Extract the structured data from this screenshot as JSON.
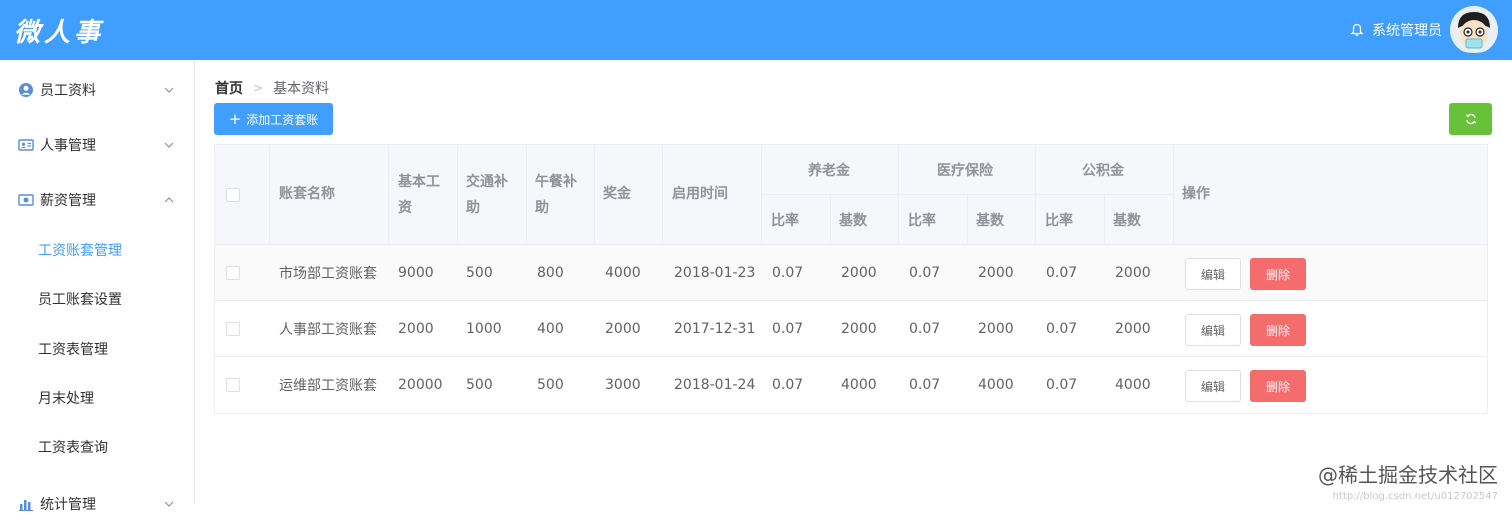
{
  "header": {
    "logo": "微人事",
    "user_name": "系统管理员",
    "bg_color": "#409eff"
  },
  "sidebar": {
    "groups": [
      {
        "label": "员工资料",
        "icon": "user-circle-icon"
      },
      {
        "label": "人事管理",
        "icon": "id-card-icon"
      },
      {
        "label": "薪资管理",
        "icon": "money-icon"
      },
      {
        "label": "统计管理",
        "icon": "bar-chart-icon"
      }
    ],
    "salary_items": [
      {
        "label": "工资账套管理",
        "active": true
      },
      {
        "label": "员工账套设置"
      },
      {
        "label": "工资表管理"
      },
      {
        "label": "月末处理"
      },
      {
        "label": "工资表查询"
      }
    ]
  },
  "breadcrumb": {
    "home": "首页",
    "separator": ">",
    "current": "基本资料"
  },
  "toolbar": {
    "add_label": "添加工资套账",
    "add_plus": "+"
  },
  "table": {
    "headers": {
      "name": "账套名称",
      "basic": "基本工资",
      "traffic": "交通补助",
      "lunch": "午餐补助",
      "bonus": "奖金",
      "start": "启用时间",
      "pension": "养老金",
      "medical": "医疗保险",
      "fund": "公积金",
      "ratio": "比率",
      "base": "基数",
      "action": "操作"
    },
    "rows": [
      {
        "name": "市场部工资账套",
        "basic": "9000",
        "traffic": "500",
        "lunch": "800",
        "bonus": "4000",
        "start": "2018-01-23",
        "pension_ratio": "0.07",
        "pension_base": "2000",
        "medical_ratio": "0.07",
        "medical_base": "2000",
        "fund_ratio": "0.07",
        "fund_base": "2000",
        "edit": "编辑",
        "delete": "删除"
      },
      {
        "name": "人事部工资账套",
        "basic": "2000",
        "traffic": "1000",
        "lunch": "400",
        "bonus": "2000",
        "start": "2017-12-31",
        "pension_ratio": "0.07",
        "pension_base": "2000",
        "medical_ratio": "0.07",
        "medical_base": "2000",
        "fund_ratio": "0.07",
        "fund_base": "2000",
        "edit": "编辑",
        "delete": "删除"
      },
      {
        "name": "运维部工资账套",
        "basic": "20000",
        "traffic": "500",
        "lunch": "500",
        "bonus": "3000",
        "start": "2018-01-24",
        "pension_ratio": "0.07",
        "pension_base": "4000",
        "medical_ratio": "0.07",
        "medical_base": "4000",
        "fund_ratio": "0.07",
        "fund_base": "4000",
        "edit": "编辑",
        "delete": "删除"
      }
    ]
  },
  "watermark": "@稀土掘金技术社区",
  "watermark_url": "http://blog.csdn.net/u012702547"
}
